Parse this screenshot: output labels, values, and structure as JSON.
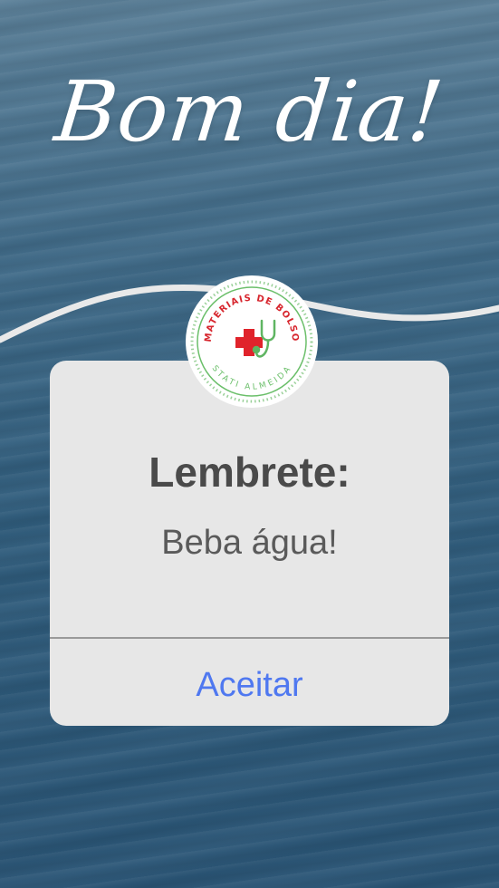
{
  "header": {
    "greeting": "Bom dia!"
  },
  "logo": {
    "top_text": "MATERIAIS DE BOLSO",
    "bottom_text": "STATI ALMEIDA",
    "colors": {
      "cross": "#e0232b",
      "ring": "#6bbf6a",
      "text": "#d7262e"
    }
  },
  "dialog": {
    "title": "Lembrete:",
    "message": "Beba água!",
    "accept_label": "Aceitar"
  },
  "colors": {
    "accent": "#4f78f0",
    "background": "#2f5c7c",
    "card": "#e7e7e7"
  }
}
